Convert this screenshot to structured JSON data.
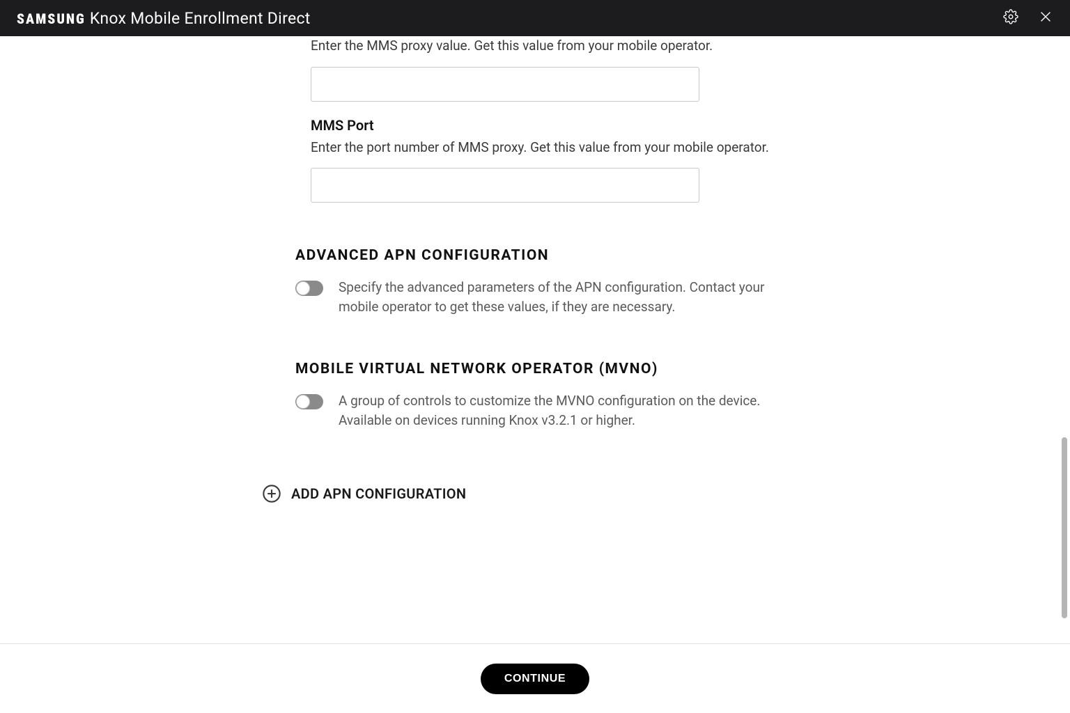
{
  "header": {
    "brand": "SAMSUNG",
    "title": "Knox Mobile Enrollment Direct"
  },
  "form": {
    "mms_proxy": {
      "desc": "Enter the MMS proxy value. Get this value from your mobile operator.",
      "value": ""
    },
    "mms_port": {
      "label": "MMS Port",
      "desc": "Enter the port number of MMS proxy. Get this value from your mobile operator.",
      "value": ""
    },
    "advanced": {
      "heading": "ADVANCED APN CONFIGURATION",
      "desc": "Specify the advanced parameters of the APN configuration. Contact your mobile operator to get these values, if they are necessary.",
      "enabled": false
    },
    "mvno": {
      "heading": "MOBILE VIRTUAL NETWORK OPERATOR (MVNO)",
      "desc": "A group of controls to customize the MVNO configuration on the device. Available on devices running Knox v3.2.1 or higher.",
      "enabled": false
    },
    "add_apn": {
      "label": "ADD APN CONFIGURATION"
    }
  },
  "footer": {
    "continue": "CONTINUE"
  }
}
